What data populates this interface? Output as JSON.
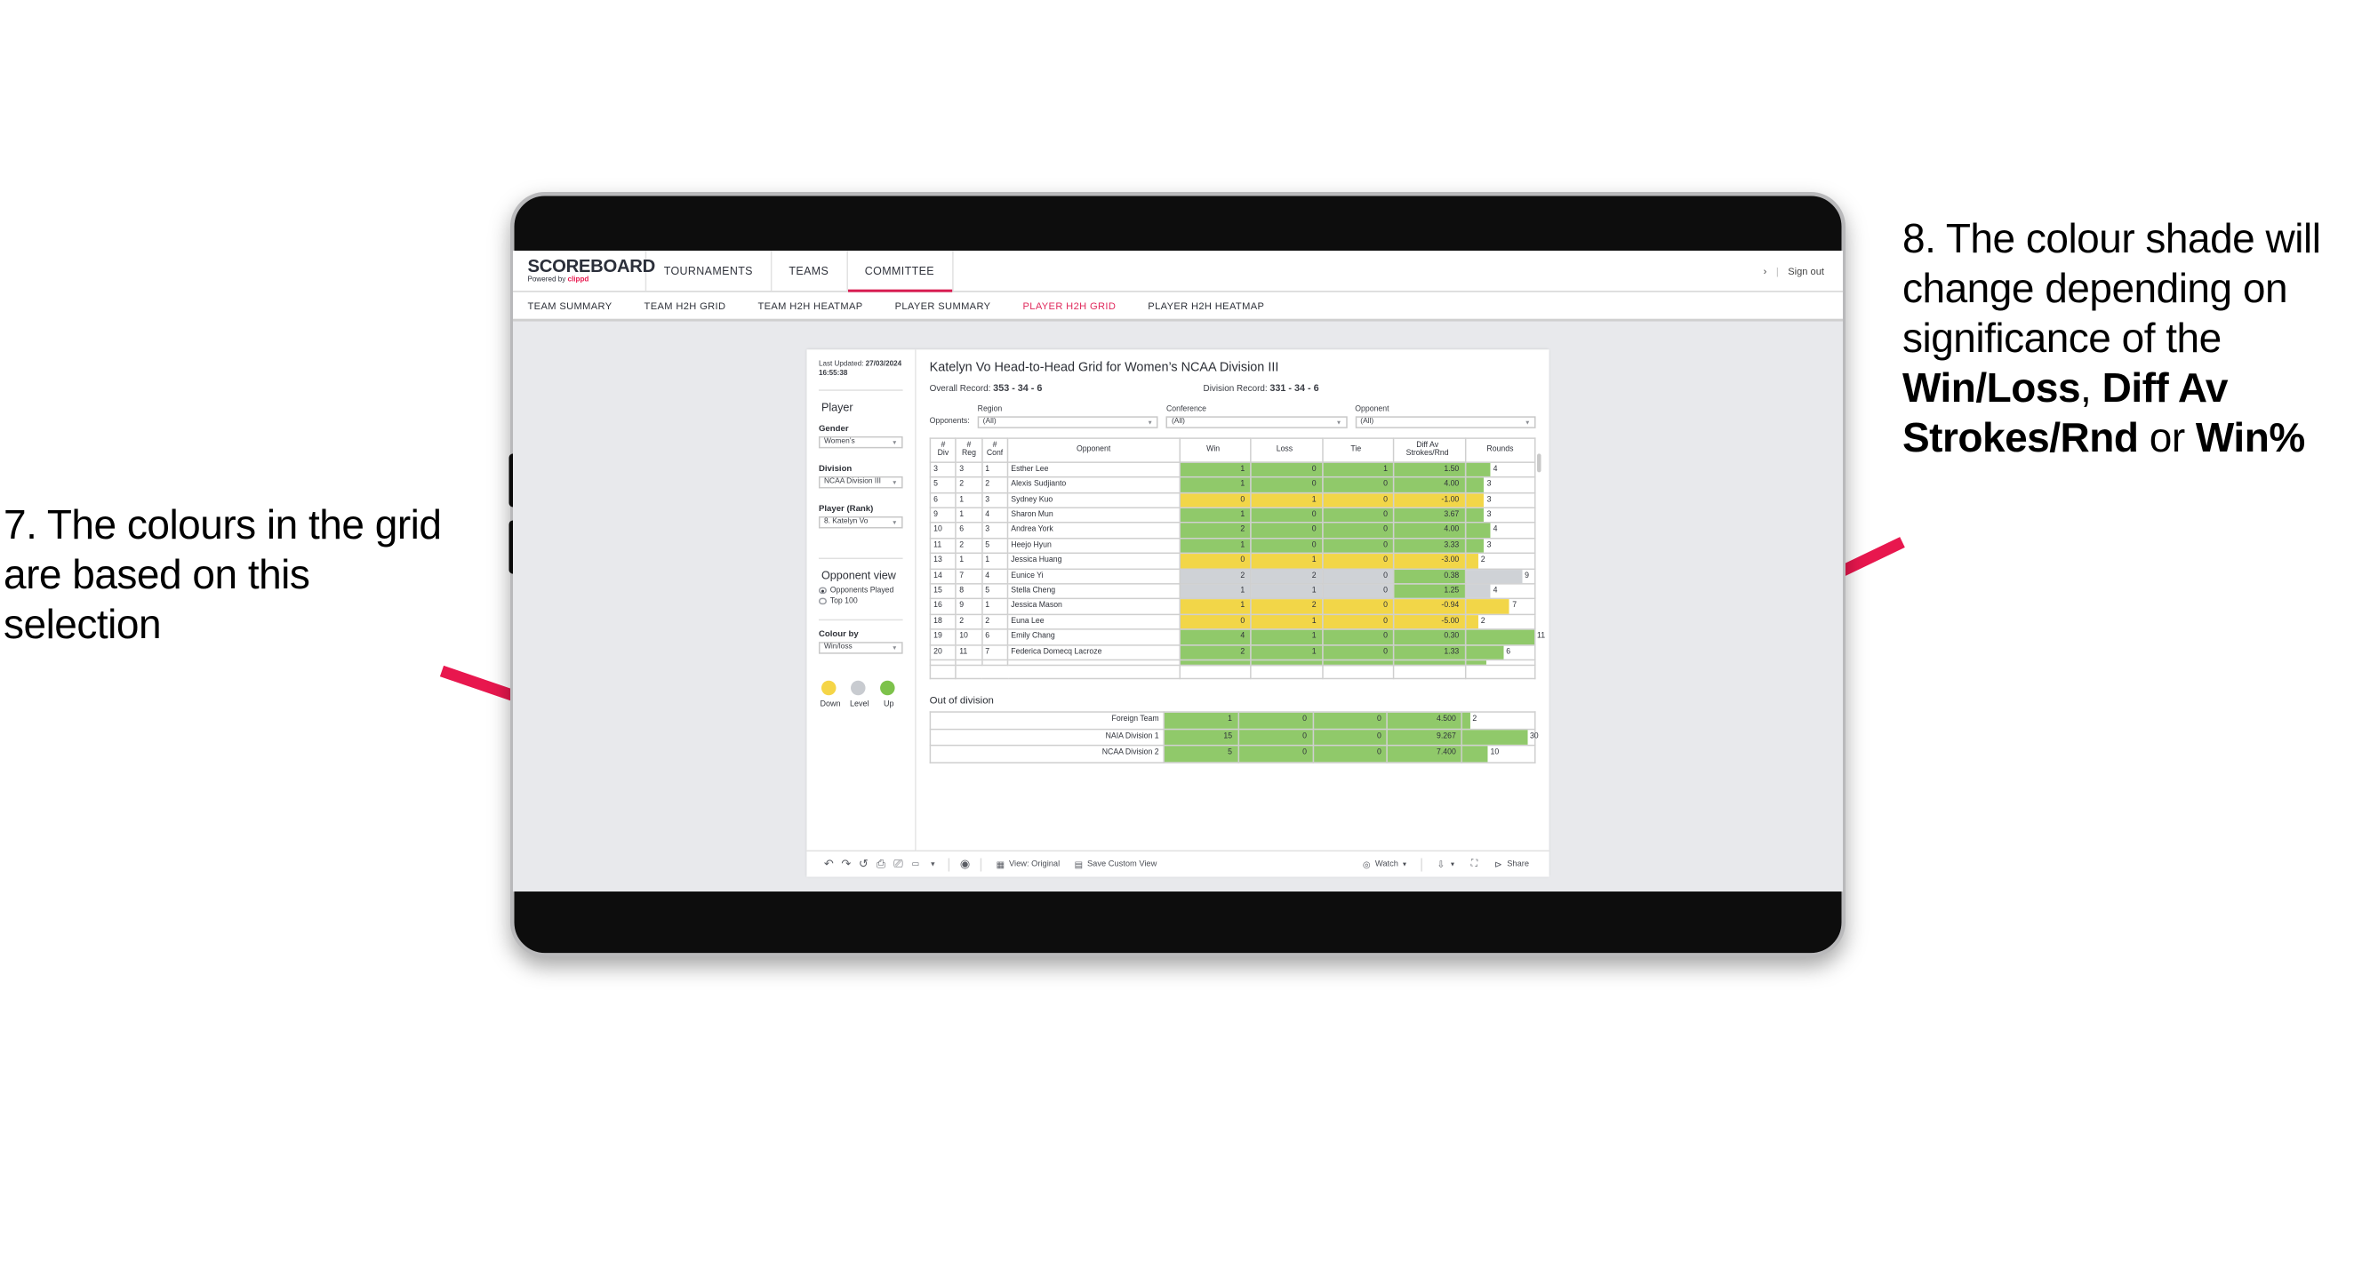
{
  "annotations": {
    "left": {
      "number": "7.",
      "text": "7. The colours in the grid are based on this selection"
    },
    "right": {
      "prefix": "8. The colour shade will change depending on significance of the ",
      "bold1": "Win/Loss",
      "mid1": ", ",
      "bold2": "Diff Av Strokes/Rnd",
      "mid2": " or ",
      "bold3": "Win%"
    },
    "arrow_color": "#e8174e"
  },
  "app": {
    "logo_main": "SCOREBOARD",
    "logo_sub_prefix": "Powered by ",
    "logo_brand": "clippd",
    "nav": [
      {
        "label": "TOURNAMENTS",
        "active": false
      },
      {
        "label": "TEAMS",
        "active": false
      },
      {
        "label": "COMMITTEE",
        "active": true
      }
    ],
    "chevron": "›",
    "divider": "|",
    "sign_out": "Sign out",
    "subnav": [
      {
        "label": "TEAM SUMMARY",
        "active": false
      },
      {
        "label": "TEAM H2H GRID",
        "active": false
      },
      {
        "label": "TEAM H2H HEATMAP",
        "active": false
      },
      {
        "label": "PLAYER SUMMARY",
        "active": false
      },
      {
        "label": "PLAYER H2H GRID",
        "active": true
      },
      {
        "label": "PLAYER H2H HEATMAP",
        "active": false
      }
    ],
    "accent_color": "#e02a5d"
  },
  "filters": {
    "last_updated_label": "Last Updated: ",
    "last_updated_value": "27/03/2024 16:55:38",
    "section_player": "Player",
    "gender_label": "Gender",
    "gender_value": "Women’s",
    "division_label": "Division",
    "division_value": "NCAA Division III",
    "player_rank_label": "Player (Rank)",
    "player_rank_value": "8. Katelyn Vo",
    "opponent_view_label": "Opponent view",
    "opponent_view_options": [
      {
        "label": "Opponents Played",
        "selected": true
      },
      {
        "label": "Top 100",
        "selected": false
      }
    ],
    "colour_by_label": "Colour by",
    "colour_by_value": "Win/loss",
    "legend": [
      {
        "label": "Down",
        "color": "#f5d547"
      },
      {
        "label": "Level",
        "color": "#c8cbd0"
      },
      {
        "label": "Up",
        "color": "#7dc24b"
      }
    ]
  },
  "viz": {
    "title": "Katelyn Vo Head-to-Head Grid for Women’s NCAA Division III",
    "overall_record_label": "Overall Record: ",
    "overall_record_value": "353 -  34 - 6",
    "division_record_label": "Division Record: ",
    "division_record_value": "331 -  34 - 6",
    "opponents_label": "Opponents:",
    "opponent_filters": [
      {
        "label": "Region",
        "value": "(All)"
      },
      {
        "label": "Conference",
        "value": "(All)"
      },
      {
        "label": "Opponent",
        "value": "(All)"
      }
    ],
    "out_of_division_title": "Out of division"
  },
  "chart_data": {
    "type": "table",
    "title": "Katelyn Vo Head-to-Head Grid for Women’s NCAA Division III",
    "columns": [
      "# Div",
      "# Reg",
      "# Conf",
      "Opponent",
      "Win",
      "Loss",
      "Tie",
      "Diff Av Strokes/Rnd",
      "Rounds"
    ],
    "column_headers_multiline": [
      {
        "l1": "#",
        "l2": "Div"
      },
      {
        "l1": "#",
        "l2": "Reg"
      },
      {
        "l1": "#",
        "l2": "Conf"
      },
      {
        "l1": "Opponent",
        "l2": ""
      },
      {
        "l1": "Win",
        "l2": ""
      },
      {
        "l1": "Loss",
        "l2": ""
      },
      {
        "l1": "Tie",
        "l2": ""
      },
      {
        "l1": "Diff Av",
        "l2": "Strokes/Rnd"
      },
      {
        "l1": "Rounds",
        "l2": ""
      }
    ],
    "rows": [
      {
        "div": "3",
        "reg": "3",
        "conf": "1",
        "opponent": "Esther Lee",
        "win": "1",
        "loss": "0",
        "tie": "1",
        "diff": "1.50",
        "rounds": "4",
        "rounds_pct": 36,
        "color": "#90c96a"
      },
      {
        "div": "5",
        "reg": "2",
        "conf": "2",
        "opponent": "Alexis Sudjianto",
        "win": "1",
        "loss": "0",
        "tie": "0",
        "diff": "4.00",
        "rounds": "3",
        "rounds_pct": 27,
        "color": "#90c96a"
      },
      {
        "div": "6",
        "reg": "1",
        "conf": "3",
        "opponent": "Sydney Kuo",
        "win": "0",
        "loss": "1",
        "tie": "0",
        "diff": "-1.00",
        "rounds": "3",
        "rounds_pct": 27,
        "color": "#f2d648"
      },
      {
        "div": "9",
        "reg": "1",
        "conf": "4",
        "opponent": "Sharon Mun",
        "win": "1",
        "loss": "0",
        "tie": "0",
        "diff": "3.67",
        "rounds": "3",
        "rounds_pct": 27,
        "color": "#90c96a"
      },
      {
        "div": "10",
        "reg": "6",
        "conf": "3",
        "opponent": "Andrea York",
        "win": "2",
        "loss": "0",
        "tie": "0",
        "diff": "4.00",
        "rounds": "4",
        "rounds_pct": 36,
        "color": "#90c96a"
      },
      {
        "div": "11",
        "reg": "2",
        "conf": "5",
        "opponent": "Heejo Hyun",
        "win": "1",
        "loss": "0",
        "tie": "0",
        "diff": "3.33",
        "rounds": "3",
        "rounds_pct": 27,
        "color": "#90c96a"
      },
      {
        "div": "13",
        "reg": "1",
        "conf": "1",
        "opponent": "Jessica Huang",
        "win": "0",
        "loss": "1",
        "tie": "0",
        "diff": "-3.00",
        "rounds": "2",
        "rounds_pct": 18,
        "color": "#f2d648"
      },
      {
        "div": "14",
        "reg": "7",
        "conf": "4",
        "opponent": "Eunice Yi",
        "win": "2",
        "loss": "2",
        "tie": "0",
        "diff": "0.38",
        "rounds": "9",
        "rounds_pct": 82,
        "color": "#cfd2d6",
        "diff_color": "#90c96a"
      },
      {
        "div": "15",
        "reg": "8",
        "conf": "5",
        "opponent": "Stella Cheng",
        "win": "1",
        "loss": "1",
        "tie": "0",
        "diff": "1.25",
        "rounds": "4",
        "rounds_pct": 36,
        "color": "#cfd2d6",
        "diff_color": "#90c96a"
      },
      {
        "div": "16",
        "reg": "9",
        "conf": "1",
        "opponent": "Jessica Mason",
        "win": "1",
        "loss": "2",
        "tie": "0",
        "diff": "-0.94",
        "rounds": "7",
        "rounds_pct": 64,
        "color": "#f2d648"
      },
      {
        "div": "18",
        "reg": "2",
        "conf": "2",
        "opponent": "Euna Lee",
        "win": "0",
        "loss": "1",
        "tie": "0",
        "diff": "-5.00",
        "rounds": "2",
        "rounds_pct": 18,
        "color": "#f2d648"
      },
      {
        "div": "19",
        "reg": "10",
        "conf": "6",
        "opponent": "Emily Chang",
        "win": "4",
        "loss": "1",
        "tie": "0",
        "diff": "0.30",
        "rounds": "11",
        "rounds_pct": 100,
        "color": "#90c96a"
      },
      {
        "div": "20",
        "reg": "11",
        "conf": "7",
        "opponent": "Federica Domecq Lacroze",
        "win": "2",
        "loss": "1",
        "tie": "0",
        "diff": "1.33",
        "rounds": "6",
        "rounds_pct": 55,
        "color": "#90c96a"
      }
    ],
    "out_of_division": [
      {
        "name": "Foreign Team",
        "win": "1",
        "loss": "0",
        "tie": "0",
        "diff": "4.500",
        "rounds": "2",
        "rounds_pct": 10,
        "color": "#90c96a"
      },
      {
        "name": "NAIA Division 1",
        "win": "15",
        "loss": "0",
        "tie": "0",
        "diff": "9.267",
        "rounds": "30",
        "rounds_pct": 90,
        "color": "#90c96a"
      },
      {
        "name": "NCAA Division 2",
        "win": "5",
        "loss": "0",
        "tie": "0",
        "diff": "7.400",
        "rounds": "10",
        "rounds_pct": 35,
        "color": "#90c96a"
      }
    ]
  },
  "toolbar": {
    "view_label": "View: Original",
    "save_label": "Save Custom View",
    "watch_label": "Watch",
    "share_label": "Share",
    "caret": "▾"
  }
}
